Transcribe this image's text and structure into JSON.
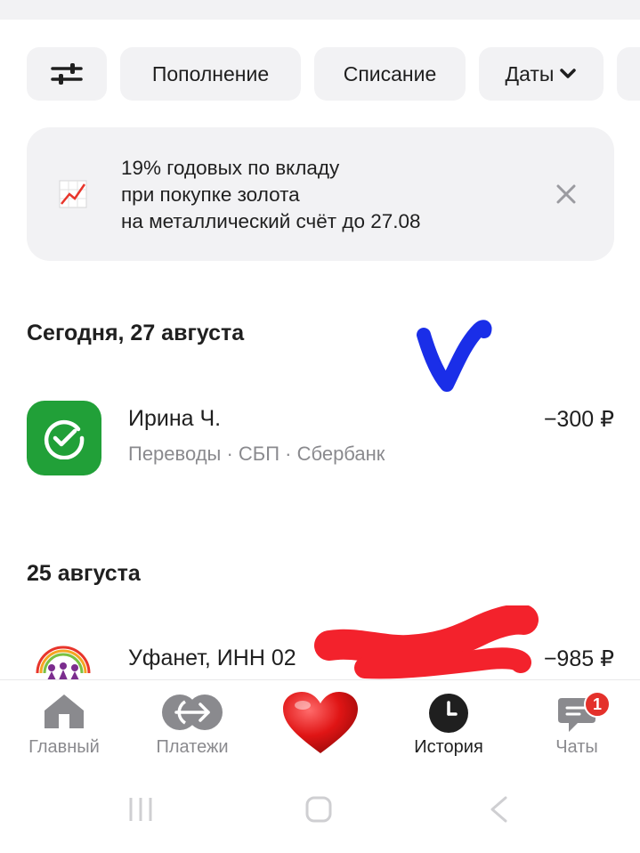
{
  "filters": {
    "settings_icon": "sliders-icon",
    "topup": "Пополнение",
    "debit": "Списание",
    "dates": "Даты"
  },
  "promo": {
    "icon": "chart-up-icon",
    "line1": "19% годовых по вкладу",
    "line2": "при покупке золота",
    "line3": "на металлический счёт до 27.08"
  },
  "groups": [
    {
      "date": "Сегодня, 27 августа",
      "transactions": [
        {
          "name": "Ирина Ч.",
          "subtitle": "Переводы · СБП · Сбербанк",
          "amount": "−300 ₽",
          "logo": "sber-logo-icon"
        }
      ]
    },
    {
      "date": "25 августа",
      "transactions": [
        {
          "name": "Уфанет, ИНН 02",
          "amount": "−985 ₽",
          "logo": "ufanet-logo-icon"
        }
      ]
    }
  ],
  "nav": {
    "home": "Главный",
    "payments": "Платежи",
    "history": "История",
    "chats": "Чаты",
    "chats_badge": "1"
  },
  "colors": {
    "accent_green": "#21a038",
    "chip_bg": "#f2f2f4",
    "badge_red": "#e4312b",
    "scribble_blue": "#1a2ee8",
    "redaction_red": "#f3222c"
  }
}
